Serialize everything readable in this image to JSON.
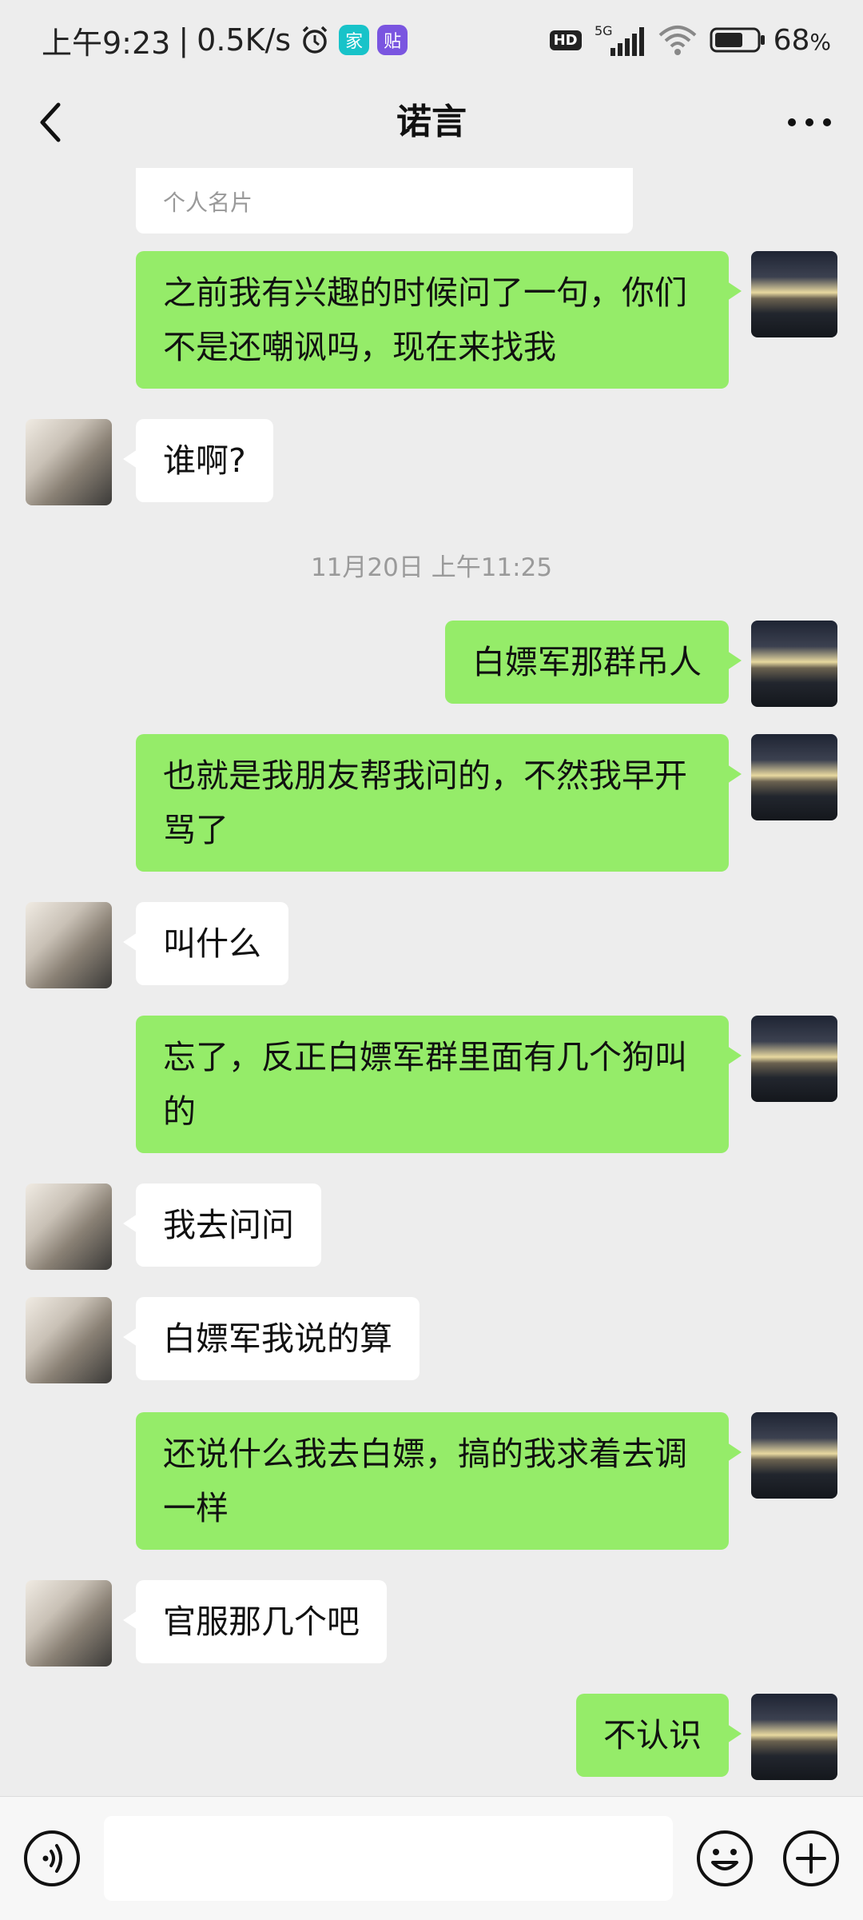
{
  "status_bar": {
    "time": "上午9:23",
    "speed": "0.5K/s",
    "app_icon_1": "家",
    "app_icon_2": "贴",
    "hd": "HD",
    "network": "5G",
    "battery": "68",
    "battery_unit": "%"
  },
  "header": {
    "title": "诺言"
  },
  "card": {
    "label": "个人名片"
  },
  "timestamp": "11月20日 上午11:25",
  "messages": [
    {
      "from": "me",
      "text": "之前我有兴趣的时候问了一句，你们不是还嘲讽吗，现在来找我"
    },
    {
      "from": "them",
      "text": "谁啊?"
    },
    {
      "from": "me",
      "text": "白嫖军那群吊人"
    },
    {
      "from": "me",
      "text": "也就是我朋友帮我问的，不然我早开骂了"
    },
    {
      "from": "them",
      "text": "叫什么"
    },
    {
      "from": "me",
      "text": "忘了，反正白嫖军群里面有几个狗叫的"
    },
    {
      "from": "them",
      "text": "我去问问"
    },
    {
      "from": "them",
      "text": "白嫖军我说的算"
    },
    {
      "from": "me",
      "text": "还说什么我去白嫖，搞的我求着去调一样"
    },
    {
      "from": "them",
      "text": "官服那几个吧"
    },
    {
      "from": "me",
      "text": "不认识"
    }
  ],
  "input": {
    "value": ""
  }
}
